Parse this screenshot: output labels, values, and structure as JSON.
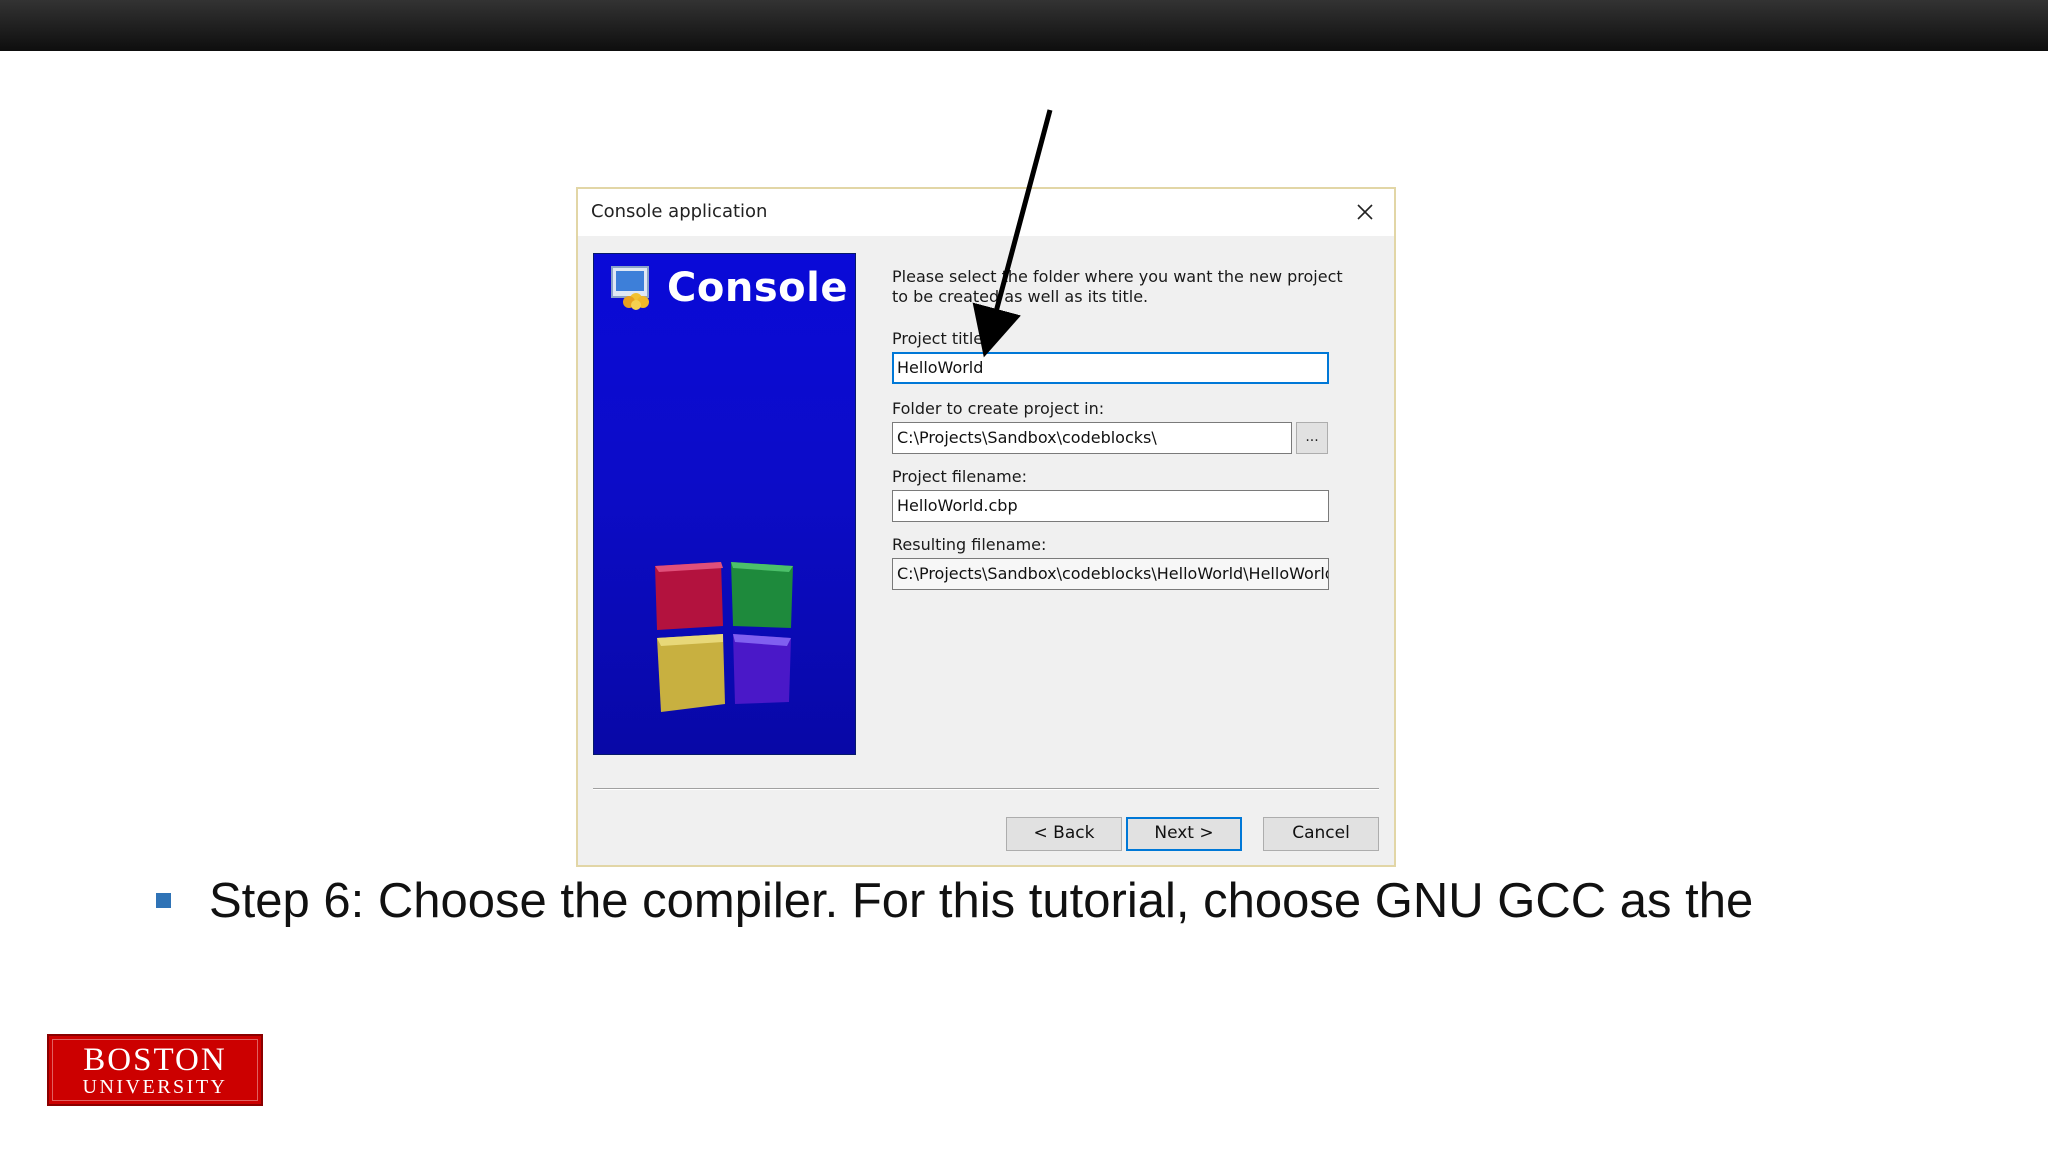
{
  "dialog": {
    "title": "Console application",
    "banner_title": "Console",
    "intro": "Please select the folder where you want the new project to be created as well as its title.",
    "fields": {
      "project_title_label": "Project title:",
      "project_title_value": "HelloWorld",
      "folder_label": "Folder to create project in:",
      "folder_value": "C:\\Projects\\Sandbox\\codeblocks\\",
      "browse_label": "...",
      "filename_label": "Project filename:",
      "filename_value": "HelloWorld.cbp",
      "resulting_label": "Resulting filename:",
      "resulting_value": "C:\\Projects\\Sandbox\\codeblocks\\HelloWorld\\HelloWorld"
    },
    "buttons": {
      "back": "< Back",
      "next": "Next >",
      "cancel": "Cancel"
    }
  },
  "slide": {
    "step_text": "Step 6: Choose the compiler.  For this tutorial, choose GNU GCC as the",
    "logo_line1": "BOSTON",
    "logo_line2": "UNIVERSITY"
  },
  "colors": {
    "accent": "#0078d7",
    "banner": "#0c0cc8",
    "bullet": "#2f73b6",
    "logo": "#cc0000"
  }
}
